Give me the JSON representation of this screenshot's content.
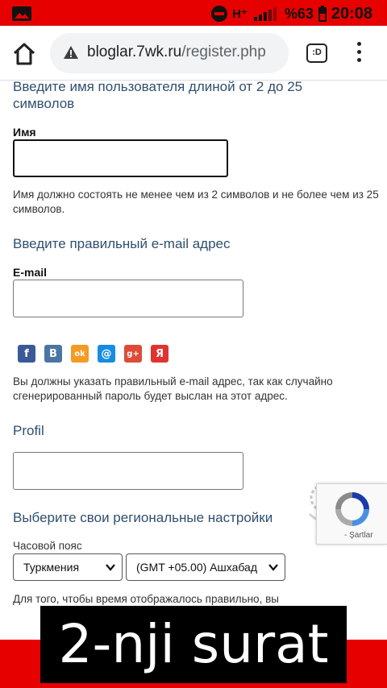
{
  "status_bar": {
    "network": "H⁺",
    "battery": "%63",
    "time": "20:08",
    "icons": [
      "picture-icon",
      "do-not-disturb-icon",
      "signal-icon",
      "battery-icon"
    ]
  },
  "browser": {
    "url_host": "bloglar.7wk.ru",
    "url_path": "/register.php",
    "tabs_count": ":D",
    "icons": [
      "home-icon",
      "not-secure-icon",
      "tabs-icon",
      "menu-icon"
    ]
  },
  "form": {
    "username_section": {
      "heading": "Введите имя пользователя длиной от 2 до 25 символов",
      "label": "Имя",
      "value": "",
      "help": "Имя должно состоять не менее чем из 2 символов и не более чем из 25 символов."
    },
    "email_section": {
      "heading": "Введите правильный e-mail адрес",
      "label": "E-mail",
      "value": "",
      "help": "Вы должны указать правильный e-mail адрес, так как случайно сгенерированный пароль будет выслан на этот адрес."
    },
    "social_icons": [
      {
        "name": "facebook-icon",
        "glyph": "f",
        "color": "#3b5998"
      },
      {
        "name": "vkontakte-icon",
        "glyph": "B",
        "color": "#4c75a3"
      },
      {
        "name": "odnoklassniki-icon",
        "glyph": "ok",
        "color": "#f59a23"
      },
      {
        "name": "mailru-icon",
        "glyph": "@",
        "color": "#168de2"
      },
      {
        "name": "google-plus-icon",
        "glyph": "g+",
        "color": "#dd4b39"
      },
      {
        "name": "yandex-icon",
        "glyph": "Я",
        "color": "#e0332f"
      }
    ],
    "profile_section": {
      "heading": "Profil",
      "value": ""
    },
    "regional_section": {
      "heading": "Выберите свои региональные настройки",
      "timezone_label": "Часовой пояс",
      "country_select": "Туркмения",
      "zone_select": "(GMT +05.00) Ашхабад",
      "help": "Для того, чтобы время отображалось правильно, вы"
    }
  },
  "recaptcha": {
    "terms": "- Şartlar"
  },
  "caption": "2-nji surat",
  "colors": {
    "status_bar": "#e60000",
    "heading": "#2f4f6f",
    "caption_bg": "#000000"
  }
}
